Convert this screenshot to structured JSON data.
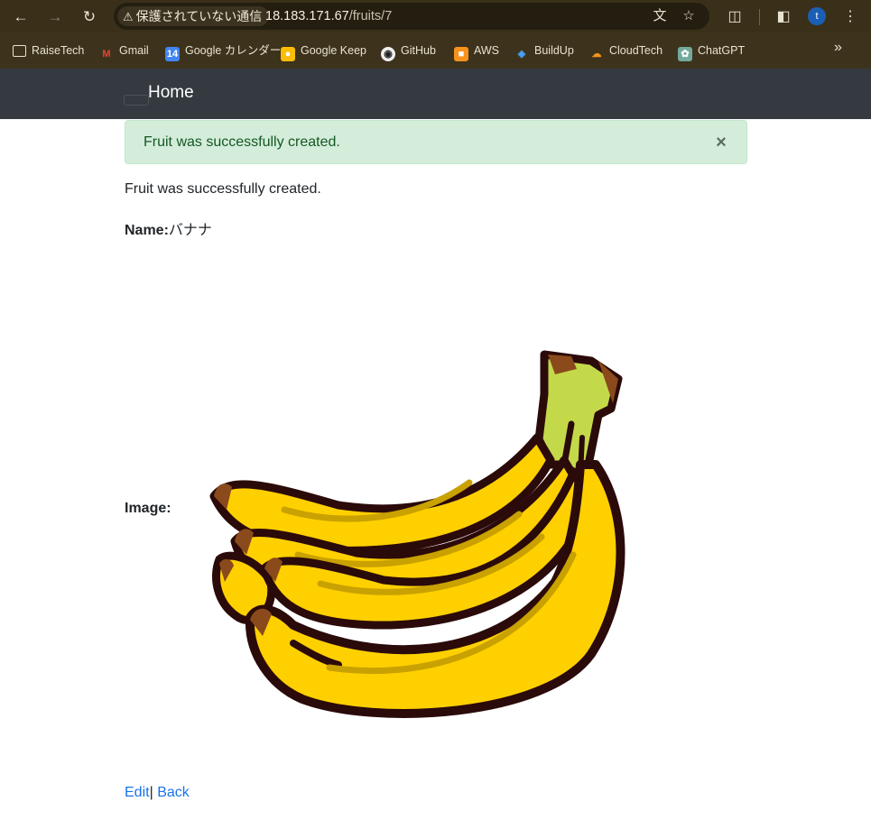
{
  "browser": {
    "nav": {
      "back_icon": "back-arrow-icon",
      "forward_icon": "forward-arrow-icon",
      "reload_icon": "reload-icon"
    },
    "security_label": "保護されていない通信",
    "url_host": "18.183.171.67",
    "url_path": "/fruits/7",
    "avatar_letter": "t",
    "bookmarks": [
      {
        "label": "RaiseTech",
        "icon": "folder-icon"
      },
      {
        "label": "Gmail",
        "icon": "gmail-icon"
      },
      {
        "label": "Google カレンダー",
        "icon": "calendar-icon"
      },
      {
        "label": "Google Keep",
        "icon": "keep-icon"
      },
      {
        "label": "GitHub",
        "icon": "github-icon"
      },
      {
        "label": "AWS",
        "icon": "aws-icon"
      },
      {
        "label": "BuildUp",
        "icon": "buildup-icon"
      },
      {
        "label": "CloudTech",
        "icon": "cloudtech-icon"
      },
      {
        "label": "ChatGPT",
        "icon": "chatgpt-icon"
      }
    ]
  },
  "app": {
    "brand": "Home",
    "alert_message": "Fruit was successfully created.",
    "alert_close": "×",
    "notice": "Fruit was successfully created.",
    "name_label": "Name:",
    "name_value": "バナナ",
    "image_label": "Image:",
    "edit_link": "Edit",
    "separator": "|",
    "back_link": "Back"
  },
  "colors": {
    "navbar_bg": "#343a40",
    "alert_bg": "#d4edda",
    "alert_text": "#155724",
    "link": "#1a73e8",
    "banana_yellow": "#ffd000",
    "banana_outline": "#2b0a0a",
    "stem_green": "#c4d94a"
  }
}
